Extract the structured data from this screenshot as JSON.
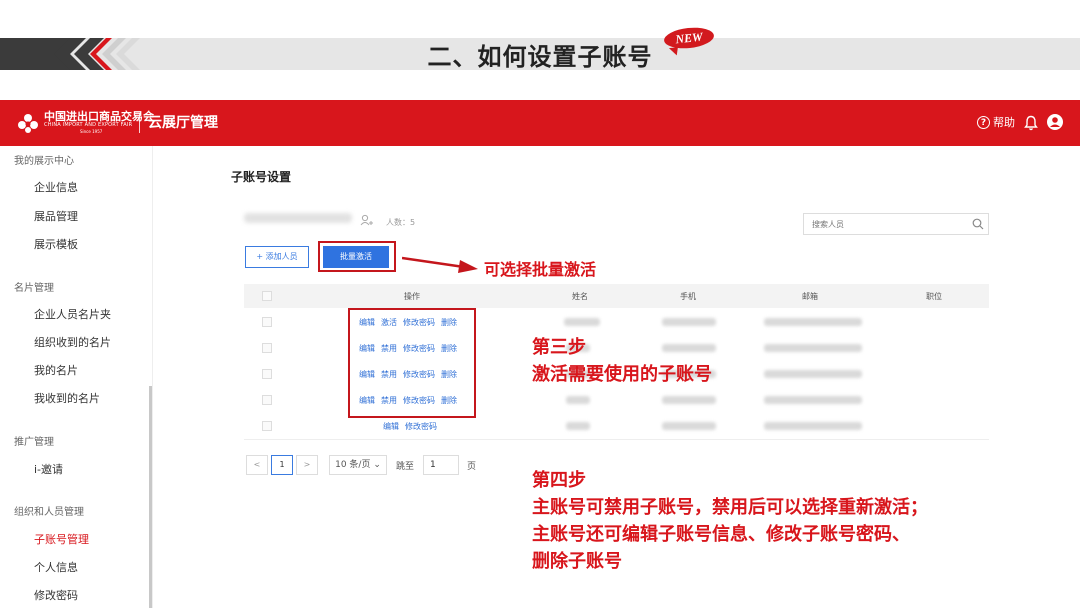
{
  "slide": {
    "title": "二、如何设置子账号",
    "badge": "NEW"
  },
  "app": {
    "logo_cn": "中国进出口商品交易会",
    "logo_en": "CHINA IMPORT AND EXPORT FAIR",
    "logo_since": "Since 1957",
    "title": "云展厅管理",
    "help_label": "帮助"
  },
  "sidebar": {
    "groups": [
      {
        "label": "我的展示中心",
        "items": [
          "企业信息",
          "展品管理",
          "展示模板"
        ]
      },
      {
        "label": "名片管理",
        "items": [
          "企业人员名片夹",
          "组织收到的名片",
          "我的名片",
          "我收到的名片"
        ]
      },
      {
        "label": "推广管理",
        "items": [
          "i-邀请"
        ]
      },
      {
        "label": "组织和人员管理",
        "items": [
          "子账号管理",
          "个人信息",
          "修改密码"
        ]
      }
    ],
    "active_item": "子账号管理"
  },
  "content": {
    "title": "子账号设置",
    "member_count": "人数：5",
    "search_placeholder": "搜索人员",
    "add_button": "+ 添加人员",
    "batch_button": "批量激活",
    "table": {
      "headers": [
        "操作",
        "姓名",
        "手机",
        "邮箱",
        "职位"
      ],
      "rows": [
        {
          "ops": [
            "编辑",
            "激活",
            "修改密码",
            "删除"
          ]
        },
        {
          "ops": [
            "编辑",
            "禁用",
            "修改密码",
            "删除"
          ]
        },
        {
          "ops": [
            "编辑",
            "禁用",
            "修改密码",
            "删除"
          ]
        },
        {
          "ops": [
            "编辑",
            "禁用",
            "修改密码",
            "删除"
          ]
        },
        {
          "ops": [
            "编辑",
            "修改密码"
          ]
        }
      ]
    },
    "pagination": {
      "prev": "<",
      "current": "1",
      "next": ">",
      "page_size": "10 条/页",
      "goto_label": "跳至",
      "goto_value": "1",
      "page_suffix": "页"
    }
  },
  "annotations": {
    "batch_note": "可选择批量激活",
    "step3_title": "第三步",
    "step3_desc": "激活需要使用的子账号",
    "step4_title": "第四步",
    "step4_lines": [
      "主账号可禁用子账号，禁用后可以选择重新激活；",
      "主账号还可编辑子账号信息、修改子账号密码、",
      "删除子账号"
    ]
  },
  "colors": {
    "brand_red": "#d8161c",
    "link_blue": "#2f6fd6",
    "primary_button": "#2f73e0"
  }
}
